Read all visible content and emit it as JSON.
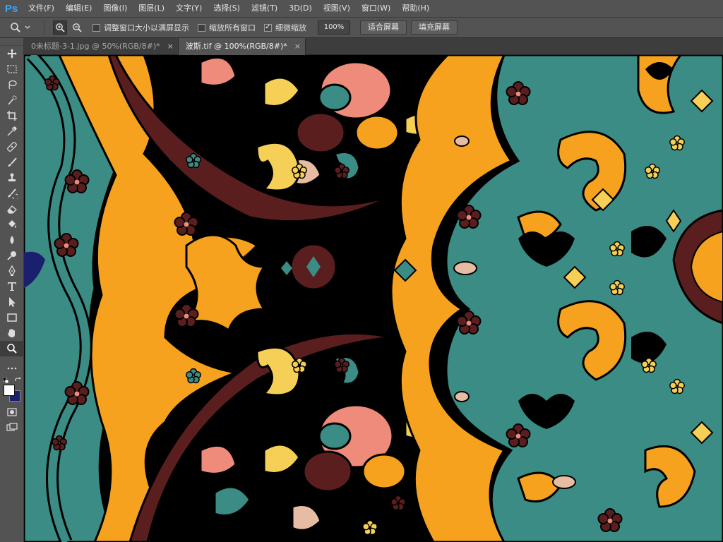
{
  "app": {
    "logo": "Ps"
  },
  "menu": [
    "文件(F)",
    "编辑(E)",
    "图像(I)",
    "图层(L)",
    "文字(Y)",
    "选择(S)",
    "滤镜(T)",
    "3D(D)",
    "视图(V)",
    "窗口(W)",
    "帮助(H)"
  ],
  "options": {
    "resize_windows": {
      "label": "调整窗口大小以满屏显示",
      "checked": false
    },
    "zoom_all": {
      "label": "缩放所有窗口",
      "checked": false
    },
    "scrubby_zoom": {
      "label": "细微缩放",
      "checked": true
    },
    "zoom_value": "100%",
    "fit_screen": "适合屏幕",
    "fill_screen": "填充屏幕"
  },
  "tabs": [
    {
      "title": "0未标题-3-1.jpg @ 50%(RGB/8#)",
      "modified": "*",
      "close": "×",
      "active": false
    },
    {
      "title": "波斯.tif @ 100%(RGB/8#)",
      "modified": "*",
      "close": "×",
      "active": true
    }
  ],
  "colors": {
    "foreground": "#ffffff",
    "background": "#1a1f6e"
  },
  "palette": {
    "black": "#000000",
    "orange": "#f6a21e",
    "teal": "#3b8c84",
    "maroon": "#5a1e1e",
    "salmon": "#ee8b7a",
    "yellow": "#f6cf56",
    "beige": "#e6bda2",
    "navy": "#1a1f6e"
  },
  "tools": [
    "move-icon",
    "marquee-icon",
    "lasso-icon",
    "quick-select-icon",
    "crop-icon",
    "eyedropper-icon",
    "healing-brush-icon",
    "brush-icon",
    "clone-stamp-icon",
    "history-brush-icon",
    "eraser-icon",
    "paint-bucket-icon",
    "blur-icon",
    "dodge-icon",
    "pen-icon",
    "type-icon",
    "path-select-icon",
    "rectangle-icon",
    "hand-icon",
    "zoom-icon"
  ]
}
